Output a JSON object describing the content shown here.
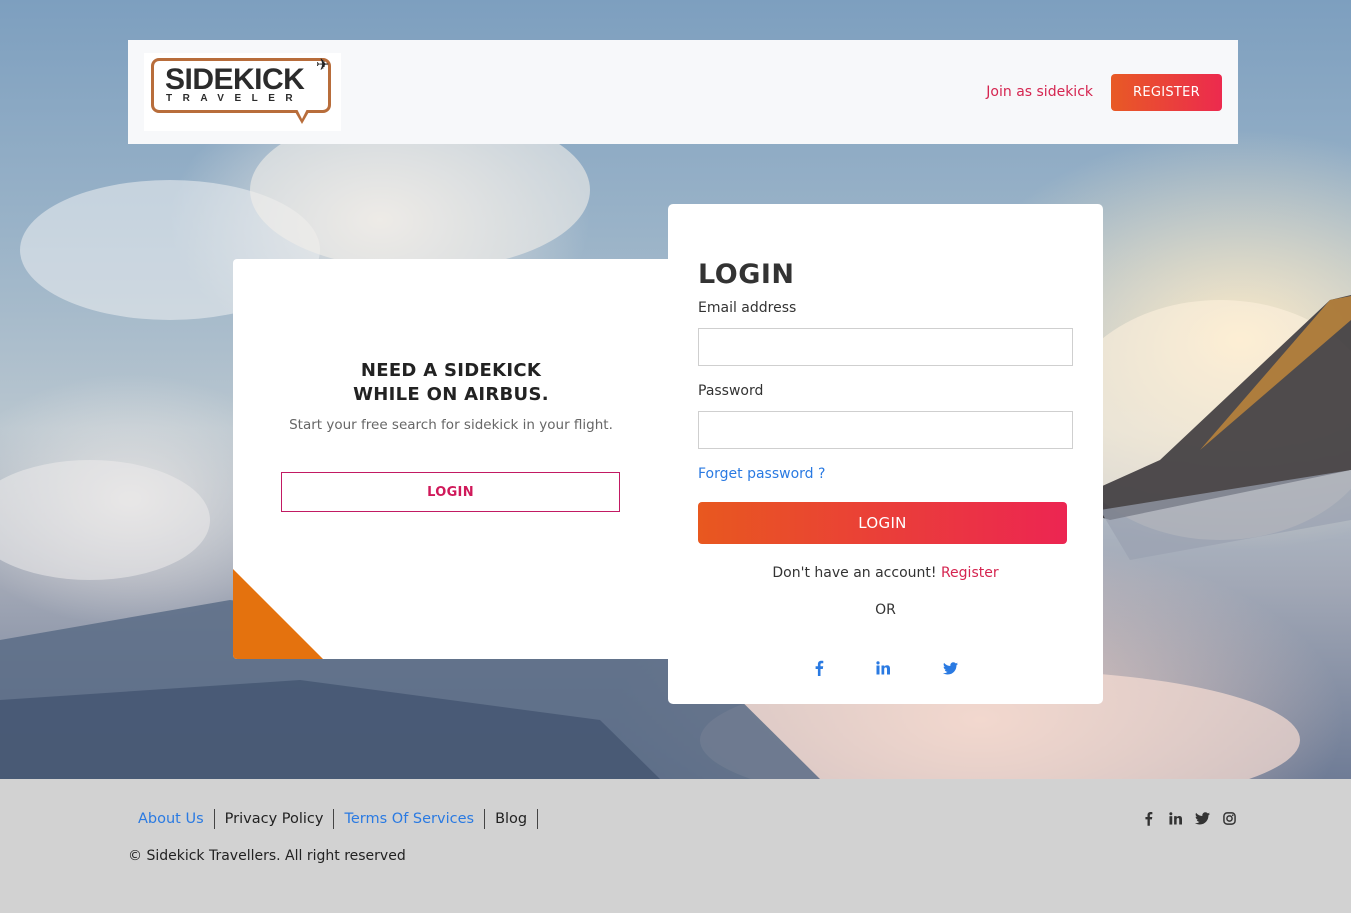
{
  "header": {
    "logo_title": "SIDEKICK",
    "logo_subtitle": "TRAVELER",
    "join_link": "Join as sidekick",
    "register_button": "REGISTER"
  },
  "promo": {
    "title_line1": "NEED A SIDEKICK",
    "title_line2": "WHILE ON AIRBUS.",
    "subtitle": "Start your free search for sidekick in your flight.",
    "login_button": "LOGIN"
  },
  "login": {
    "heading": "LOGIN",
    "email_label": "Email address",
    "email_value": "",
    "password_label": "Password",
    "password_value": "",
    "forgot_link": "Forget password ?",
    "submit_button": "LOGIN",
    "no_account_text": "Don't have an account!",
    "register_link": "Register",
    "or_text": "OR",
    "social_icons": [
      "facebook-icon",
      "linkedin-icon",
      "twitter-icon"
    ],
    "social_color": "#2a7ae2"
  },
  "footer": {
    "links": [
      "About Us",
      "Privacy Policy",
      "Terms Of Services",
      "Blog"
    ],
    "copyright": "© Sidekick Travellers. All right reserved",
    "social_icons": [
      "facebook-icon",
      "linkedin-icon",
      "twitter-icon",
      "instagram-icon"
    ]
  },
  "colors": {
    "accent": "#ec2a4e",
    "accent_orange": "#e8581f",
    "corner": "#e4720e",
    "link_blue": "#2a7ae2",
    "footer_bg": "#d2d2d2"
  }
}
